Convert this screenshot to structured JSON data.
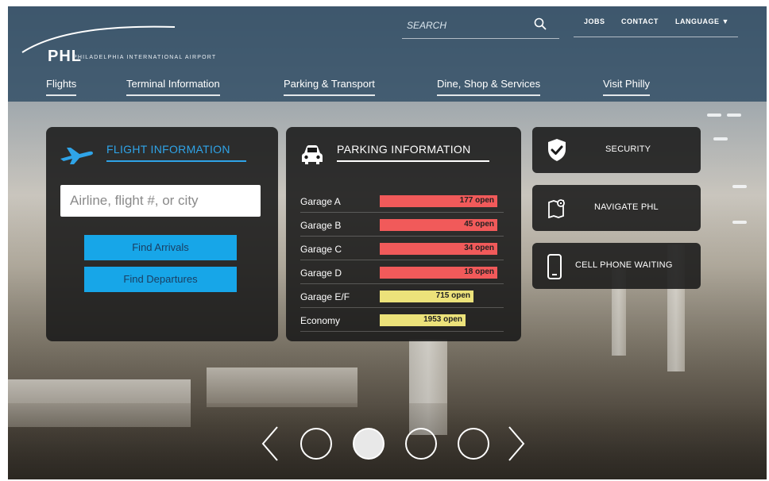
{
  "header": {
    "logo_text": "PHL",
    "logo_subtitle": "PHILADELPHIA INTERNATIONAL AIRPORT",
    "search_placeholder": "SEARCH",
    "utility_links": [
      "JOBS",
      "CONTACT",
      "LANGUAGE ▼"
    ],
    "nav": [
      "Flights",
      "Terminal Information",
      "Parking & Transport",
      "Dine, Shop & Services",
      "Visit Philly"
    ]
  },
  "flight_info": {
    "title": "FLIGHT INFORMATION",
    "search_placeholder": "Airline, flight #, or city",
    "arrivals_label": "Find Arrivals",
    "departures_label": "Find Departures"
  },
  "parking_info": {
    "title": "PARKING INFORMATION",
    "garages": [
      {
        "name": "Garage A",
        "value": "177 open",
        "fill": 1.0,
        "color": "#f15a5a"
      },
      {
        "name": "Garage B",
        "value": "45 open",
        "fill": 1.0,
        "color": "#f15a5a"
      },
      {
        "name": "Garage C",
        "value": "34 open",
        "fill": 1.0,
        "color": "#f15a5a"
      },
      {
        "name": "Garage D",
        "value": "18 open",
        "fill": 1.0,
        "color": "#f15a5a"
      },
      {
        "name": "Garage E/F",
        "value": "715 open",
        "fill": 0.8,
        "color": "#ece27a"
      },
      {
        "name": "Economy",
        "value": "1953 open",
        "fill": 0.73,
        "color": "#ece27a"
      }
    ]
  },
  "side_buttons": {
    "security": "SECURITY",
    "navigate": "NAVIGATE PHL",
    "cellphone": "CELL PHONE WAITING"
  },
  "carousel": {
    "slide_count": 4,
    "active_index": 2
  },
  "colors": {
    "header_bg": "#345068",
    "accent_blue": "#17a6e8",
    "bar_red": "#f15a5a",
    "bar_yellow": "#ece27a"
  }
}
